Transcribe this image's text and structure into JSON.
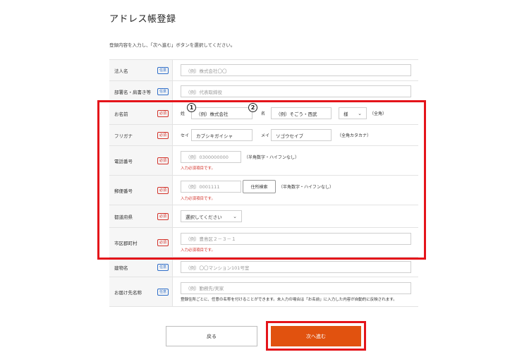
{
  "page": {
    "title": "アドレス帳登録",
    "instruction": "登録内容を入力し、「次へ進む」ボタンを選択してください。"
  },
  "badges": {
    "optional": "任意",
    "required": "必須"
  },
  "fields": {
    "company": {
      "label": "法人名",
      "placeholder": "（例）株式会社〇〇"
    },
    "department": {
      "label": "部署名・肩書き等",
      "placeholder": "（例）代表取締役"
    },
    "name": {
      "label": "お名前",
      "sei_label": "姓",
      "sei_value": "（例）株式会社",
      "mei_label": "名",
      "mei_value": "（例）そごう・西武",
      "honorific": "様",
      "note": "（全角）"
    },
    "furigana": {
      "label": "フリガナ",
      "sei_label": "セイ",
      "sei_value": "カブシキガイシャ",
      "mei_label": "メイ",
      "mei_value": "ソゴウセイブ",
      "note": "（全角カタカナ）"
    },
    "phone": {
      "label": "電話番号",
      "placeholder": "（例）0300000000",
      "note": "（半角数字・ハイフンなし）",
      "error": "入力必須項目です。"
    },
    "postal": {
      "label": "郵便番号",
      "placeholder": "（例）0001111",
      "search_button": "住所検索",
      "note": "（半角数字・ハイフンなし）",
      "error": "入力必須項目です。"
    },
    "prefecture": {
      "label": "都道府県",
      "selected": "選択してください"
    },
    "city": {
      "label": "市区郡町村",
      "placeholder": "（例）豊島区２－３－１",
      "error": "入力必須項目です。"
    },
    "building": {
      "label": "建物名",
      "placeholder": "（例）〇〇マンション101号室"
    },
    "destination": {
      "label": "お届け先名称",
      "placeholder": "（例）勤務先/実家",
      "note": "登録住所ごとに、任意の名称を付けることができます。未入力の場合は「お名前」に入力した内容が自動的に反映されます。"
    }
  },
  "annotations": {
    "one": "1",
    "two": "2"
  },
  "buttons": {
    "back": "戻る",
    "next": "次へ進む"
  },
  "colors": {
    "accent": "#e1520f",
    "highlight": "#e4141a",
    "required": "#d3322a",
    "optional": "#2f6fc9"
  }
}
